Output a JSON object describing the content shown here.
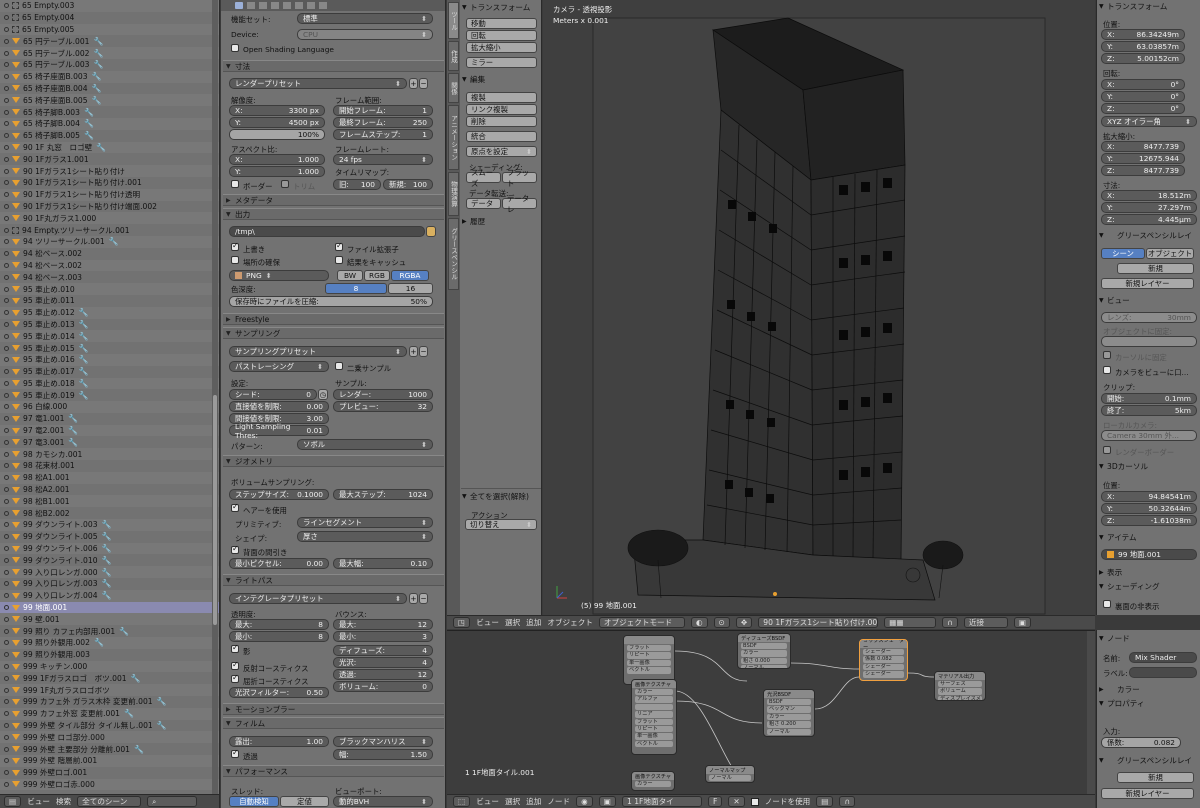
{
  "outliner": {
    "rows": [
      {
        "name": "65 Empty.003",
        "kind": "empty",
        "wrench": false
      },
      {
        "name": "65 Empty.004",
        "kind": "empty",
        "wrench": false
      },
      {
        "name": "65 Empty.005",
        "kind": "empty",
        "wrench": false
      },
      {
        "name": "65 円テーブル.001",
        "kind": "mesh",
        "wrench": true
      },
      {
        "name": "65 円テーブル.002",
        "kind": "mesh",
        "wrench": true
      },
      {
        "name": "65 円テーブル.003",
        "kind": "mesh",
        "wrench": true
      },
      {
        "name": "65 椅子座面B.003",
        "kind": "mesh",
        "wrench": true
      },
      {
        "name": "65 椅子座面B.004",
        "kind": "mesh",
        "wrench": true
      },
      {
        "name": "65 椅子座面B.005",
        "kind": "mesh",
        "wrench": true
      },
      {
        "name": "65 椅子脚B.003",
        "kind": "mesh",
        "wrench": true
      },
      {
        "name": "65 椅子脚B.004",
        "kind": "mesh",
        "wrench": true
      },
      {
        "name": "65 椅子脚B.005",
        "kind": "mesh",
        "wrench": true
      },
      {
        "name": "90 1F 丸窓　ロゴ壁",
        "kind": "mesh",
        "wrench": true
      },
      {
        "name": "90 1Fガラス1.001",
        "kind": "mesh",
        "wrench": false
      },
      {
        "name": "90 1Fガラス1シート貼り付け",
        "kind": "mesh",
        "wrench": false
      },
      {
        "name": "90 1Fガラス1シート貼り付け.001",
        "kind": "mesh",
        "wrench": false
      },
      {
        "name": "90 1Fガラス1シート貼り付け透明",
        "kind": "mesh",
        "wrench": false
      },
      {
        "name": "90 1Fガラス1シート貼り付け端面.002",
        "kind": "mesh",
        "wrench": false
      },
      {
        "name": "90 1F丸ガラス1.000",
        "kind": "mesh",
        "wrench": false
      },
      {
        "name": "94 Empty.ツリーサークル.001",
        "kind": "empty",
        "wrench": false
      },
      {
        "name": "94 ツリーサークル.001",
        "kind": "mesh",
        "wrench": true
      },
      {
        "name": "94 松ベース.002",
        "kind": "mesh",
        "wrench": false
      },
      {
        "name": "94 松ベース.002",
        "kind": "mesh",
        "wrench": false
      },
      {
        "name": "94 松ベース.003",
        "kind": "mesh",
        "wrench": false
      },
      {
        "name": "95 車止め.010",
        "kind": "mesh",
        "wrench": false
      },
      {
        "name": "95 車止め.011",
        "kind": "mesh",
        "wrench": false
      },
      {
        "name": "95 車止め.012",
        "kind": "mesh",
        "wrench": true
      },
      {
        "name": "95 車止め.013",
        "kind": "mesh",
        "wrench": true
      },
      {
        "name": "95 車止め.014",
        "kind": "mesh",
        "wrench": true
      },
      {
        "name": "95 車止め.015",
        "kind": "mesh",
        "wrench": true
      },
      {
        "name": "95 車止め.016",
        "kind": "mesh",
        "wrench": true
      },
      {
        "name": "95 車止め.017",
        "kind": "mesh",
        "wrench": true
      },
      {
        "name": "95 車止め.018",
        "kind": "mesh",
        "wrench": true
      },
      {
        "name": "95 車止め.019",
        "kind": "mesh",
        "wrench": true
      },
      {
        "name": "96 白線.000",
        "kind": "mesh",
        "wrench": false
      },
      {
        "name": "97 竜1.001",
        "kind": "mesh",
        "wrench": true
      },
      {
        "name": "97 竜2.001",
        "kind": "mesh",
        "wrench": true
      },
      {
        "name": "97 竜3.001",
        "kind": "mesh",
        "wrench": true
      },
      {
        "name": "98 カモシカ.001",
        "kind": "mesh",
        "wrench": false
      },
      {
        "name": "98 花束材.001",
        "kind": "mesh",
        "wrench": false
      },
      {
        "name": "98 松A1.001",
        "kind": "mesh",
        "wrench": false
      },
      {
        "name": "98 松A2.001",
        "kind": "mesh",
        "wrench": false
      },
      {
        "name": "98 松B1.001",
        "kind": "mesh",
        "wrench": false
      },
      {
        "name": "98 松B2.002",
        "kind": "mesh",
        "wrench": false
      },
      {
        "name": "99 ダウンライト.003",
        "kind": "mesh",
        "wrench": true
      },
      {
        "name": "99 ダウンライト.005",
        "kind": "mesh",
        "wrench": true
      },
      {
        "name": "99 ダウンライト.006",
        "kind": "mesh",
        "wrench": true
      },
      {
        "name": "99 ダウンライト.010",
        "kind": "mesh",
        "wrench": true
      },
      {
        "name": "99 入り口レンガ.000",
        "kind": "mesh",
        "wrench": true
      },
      {
        "name": "99 入り口レンガ.003",
        "kind": "mesh",
        "wrench": true
      },
      {
        "name": "99 入り口レンガ.004",
        "kind": "mesh",
        "wrench": true
      },
      {
        "name": "99 地面.001",
        "kind": "mesh",
        "wrench": false,
        "selected": true
      },
      {
        "name": "99 壁.001",
        "kind": "mesh",
        "wrench": false
      },
      {
        "name": "99 照り カフェ内部用.001",
        "kind": "mesh",
        "wrench": true
      },
      {
        "name": "99 照り外観用.002",
        "kind": "mesh",
        "wrench": true
      },
      {
        "name": "99 照り外観用.003",
        "kind": "mesh",
        "wrench": false
      },
      {
        "name": "999 キッチン.000",
        "kind": "mesh",
        "wrench": false
      },
      {
        "name": "999 1Fガラスロゴ　ボツ.001",
        "kind": "mesh",
        "wrench": true
      },
      {
        "name": "999 1F丸ガラスロゴボツ",
        "kind": "mesh",
        "wrench": false
      },
      {
        "name": "999 カフェ外 ガラス木枠 変更前.001",
        "kind": "mesh",
        "wrench": true
      },
      {
        "name": "999 カフェ外窓 変更前.001",
        "kind": "mesh",
        "wrench": true
      },
      {
        "name": "999 外壁 タイル部分 タイル無し.001",
        "kind": "mesh",
        "wrench": true
      },
      {
        "name": "999 外壁 ロゴ部分.000",
        "kind": "mesh",
        "wrench": false
      },
      {
        "name": "999 外壁 主要部分 分離前.001",
        "kind": "mesh",
        "wrench": true
      },
      {
        "name": "999 外壁 階層前.001",
        "kind": "mesh",
        "wrench": false
      },
      {
        "name": "999 外壁ロゴ.001",
        "kind": "mesh",
        "wrench": false
      },
      {
        "name": "999 外壁ロゴ赤.000",
        "kind": "mesh",
        "wrench": false
      }
    ],
    "footer": {
      "view": "ビュー",
      "search_label": "検索",
      "filter": "全てのシーン"
    }
  },
  "properties": {
    "feature_set_label": "機能セット:",
    "feature_set": "標準",
    "device_label": "Device:",
    "device": "CPU",
    "osl": "Open Shading Language",
    "dimensions": {
      "title": "寸法",
      "preset": "レンダープリセット",
      "resolution": "解像度:",
      "x_label": "X:",
      "x": "3300 px",
      "y_label": "Y:",
      "y": "4500 px",
      "pct": "100%",
      "frame_range": "フレーム範囲:",
      "start_label": "開始フレーム:",
      "start": "1",
      "end_label": "最終フレーム:",
      "end": "250",
      "step_label": "フレームステップ:",
      "step": "1",
      "aspect": "アスペクト比:",
      "ax": "1.000",
      "ay": "1.000",
      "frame_rate": "フレームレート:",
      "fps": "24 fps",
      "border": "ボーダー",
      "crop": "トリム",
      "time_remap": "タイムリマップ:",
      "old_label": "旧:",
      "old": "100",
      "new_label": "新規:",
      "new": "100"
    },
    "metadata": "メタデータ",
    "output": {
      "title": "出力",
      "path": "/tmp\\",
      "overwrite": "上書き",
      "extension": "ファイル拡張子",
      "placeholders": "場所の確保",
      "cache": "結果をキャッシュ",
      "format": "PNG",
      "bw": "BW",
      "rgb": "RGB",
      "rgba": "RGBA",
      "depth_label": "色深度:",
      "d8": "8",
      "d16": "16",
      "compress_label": "保存時にファイルを圧縮:",
      "compress": "50%"
    },
    "freestyle": "Freestyle",
    "sampling": {
      "title": "サンプリング",
      "preset": "サンプリングプリセット",
      "mode": "パストレーシング",
      "square": "二乗サンプル",
      "settings": "設定:",
      "seed_label": "シード:",
      "seed": "0",
      "direct_label": "直接値を制限:",
      "direct": "0.00",
      "indirect_label": "間接値を制限:",
      "indirect": "3.00",
      "lst_label": "Light Sampling Thres:",
      "lst": "0.01",
      "samples": "サンプル:",
      "render_label": "レンダー:",
      "render": "1000",
      "preview_label": "プレビュー:",
      "preview": "32",
      "pattern_label": "パターン:",
      "pattern": "ソボル"
    },
    "geometry": {
      "title": "ジオメトリ",
      "volume": "ボリュームサンプリング:",
      "stepsize_label": "ステップサイズ:",
      "stepsize": "0.1000",
      "maxsteps_label": "最大ステップ:",
      "maxsteps": "1024",
      "hair": "ヘアーを使用",
      "primitive_label": "プリミティブ:",
      "primitive": "ラインセグメント",
      "shape_label": "シェイプ:",
      "shape": "厚さ",
      "cull": "背面の間引き",
      "minpx_label": "最小ピクセル:",
      "minpx": "0.00",
      "maxw_label": "最大幅:",
      "maxw": "0.10"
    },
    "lightpaths": {
      "title": "ライトパス",
      "preset": "インテグレータプリセット",
      "transp": "透明度:",
      "tmax_label": "最大:",
      "tmax": "8",
      "tmin_label": "最小:",
      "tmin": "8",
      "bounces": "バウンス:",
      "bmax_label": "最大:",
      "bmax": "12",
      "bmin_label": "最小:",
      "bmin": "3",
      "shadows": "影",
      "diffuse_label": "ディフューズ:",
      "diffuse": "4",
      "gloss_label": "光沢:",
      "gloss": "4",
      "trans_label": "透過:",
      "trans": "12",
      "vol_label": "ボリューム:",
      "vol": "0",
      "refl": "反射コースティクス",
      "refr": "屈折コースティクス",
      "filter_label": "光沢フィルター:",
      "filter": "0.50"
    },
    "motionblur": "モーションブラー",
    "film": {
      "title": "フィルム",
      "exposure_label": "露出:",
      "exposure": "1.00",
      "filter": "ブラックマンハリス",
      "transparent": "透過",
      "width_label": "幅:",
      "width": "1.50"
    },
    "performance": {
      "title": "パフォーマンス",
      "threads": "スレッド:",
      "auto": "自動検知",
      "fixed": "定値",
      "viewport": "ビューポート:",
      "bvh": "動的BVH"
    }
  },
  "shelf": {
    "tabs": [
      "ツール",
      "作成",
      "関係",
      "アニメーション",
      "物理演算",
      "グリースペンシル"
    ],
    "transform": "トランスフォーム",
    "move": "移動",
    "rotate": "回転",
    "scale": "拡大縮小",
    "mirror": "ミラー",
    "edit": "編集",
    "duplicate": "複製",
    "linked": "リンク複製",
    "delete": "削除",
    "join": "統合",
    "origin": "原点を設定",
    "shading": "シェーディング:",
    "smooth": "スムーズ",
    "flat": "フラット",
    "data_transfer": "データ転送:",
    "data": "データ",
    "data_layers": "データレ",
    "history": "履歴",
    "select_all": "全てを選択(解除)",
    "action_label": "アクション",
    "action": "切り替え"
  },
  "viewport": {
    "camera": "カメラ - 透視投影",
    "units": "Meters x 0.001",
    "object": "(5) 99 地面.001"
  },
  "header3d": {
    "view": "ビュー",
    "select": "選択",
    "add": "追加",
    "object": "オブジェクト",
    "mode": "オブジェクトモード",
    "active": "90 1Fガラス1シート貼り付け.001",
    "snap": "近接"
  },
  "nbar": {
    "transform": "トランスフォーム",
    "location": "位置:",
    "lx": "86.34249m",
    "ly": "63.03857m",
    "lz": "5.00152cm",
    "rotation": "回転:",
    "rx": "0°",
    "ry": "0°",
    "rz": "0°",
    "euler": "XYZ オイラー角",
    "scale": "拡大縮小:",
    "sx": "8477.739",
    "sy": "12675.944",
    "sz": "8477.739",
    "dims": "寸法:",
    "dx": "18.512m",
    "dy": "27.297m",
    "dz": "4.445μm",
    "gp": "グリースペンシルレイ",
    "scene": "シーン",
    "objectbtn": "オブジェクト",
    "new": "新規",
    "new_layer": "新規レイヤー",
    "view": "ビュー",
    "lens_label": "レンズ:",
    "lens": "30mm",
    "lock": "オブジェクトに固定:",
    "lock_cursor": "カーソルに固定",
    "lock_camera": "カメラをビューに口...",
    "clip": "クリップ:",
    "clip_start_label": "開始:",
    "clip_start": "0.1mm",
    "clip_end_label": "終了:",
    "clip_end": "5km",
    "local_camera": "ローカルカメラ:",
    "camera_name": "Camera 30mm 外...",
    "render_border": "レンダーボーダー",
    "cursor": "3Dカーソル",
    "cursor_loc": "位置:",
    "cx": "94.84541m",
    "cy": "50.32644m",
    "cz": "-1.61038m",
    "item": "アイテム",
    "item_name": "99 地面.001",
    "display": "表示",
    "shading": "シェーディング",
    "backface": "裏面の非表示"
  },
  "nodes": {
    "footer": "1 1F地面タイル.001",
    "header": {
      "view": "ビュー",
      "select": "選択",
      "add": "追加",
      "node": "ノード",
      "material": "1 1F地面タイル.001",
      "use_nodes": "ノードを使用"
    },
    "list": [
      {
        "title": "",
        "rows": [
          "フラット",
          "リピート",
          "単一画像",
          "ベクトル"
        ]
      },
      {
        "title": "ディフューズBSDF",
        "rows": [
          "BSDF",
          "カラー",
          "粗さ 0.000",
          "ノーマル"
        ]
      },
      {
        "title": "ミックスシェーダー",
        "rows": [
          "シェーダー",
          "係数 0.082",
          "シェーダー",
          "シェーダー"
        ]
      },
      {
        "title": "マテリアル出力",
        "rows": [
          "サーフェス",
          "ボリューム",
          "ディスプレイスメ"
        ]
      },
      {
        "title": "画像テクスチャ",
        "rows": [
          "カラー",
          "アルファ",
          "",
          "リニア",
          "フラット",
          "リピート",
          "単一画像",
          "ベクトル"
        ]
      },
      {
        "title": "光沢BSDF",
        "rows": [
          "BSDF",
          "ベックマン",
          "カラー",
          "粗さ 0.200",
          "ノーマル"
        ]
      },
      {
        "title": "ノーマルマップ",
        "rows": [
          "ノーマル"
        ]
      },
      {
        "title": "画像テクスチャ",
        "rows": [
          "カラー"
        ]
      }
    ]
  },
  "nodeside": {
    "node": "ノード",
    "name_label": "名前:",
    "name": "Mix Shader",
    "label_label": "ラベル:",
    "color": "カラー",
    "props": "プロパティ",
    "input": "入力:",
    "fac_label": "係数:",
    "fac": "0.082",
    "gp": "グリースペンシルレイ",
    "new": "新規",
    "new_layer": "新規レイヤー"
  },
  "colors": {
    "accent": "#5680c2",
    "panel": "#727272",
    "viewport": "#3f3f3f",
    "mesh_icon": "#e8a030"
  }
}
